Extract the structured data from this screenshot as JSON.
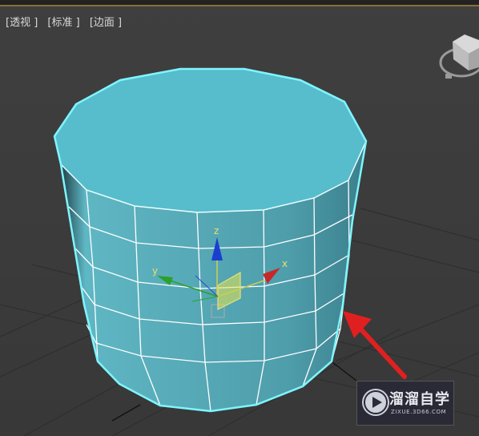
{
  "viewport": {
    "labels": [
      "[透视]",
      "[标准]",
      "[边面]"
    ],
    "label_texts": {
      "view": "[透视 ]",
      "shading": "[标准 ]",
      "edges": "[边面 ]"
    }
  },
  "gizmo": {
    "axis_x": "x",
    "axis_y": "y",
    "axis_z": "z"
  },
  "colors": {
    "mesh_fill": "#57bccb",
    "mesh_edge": "#ffffff",
    "selection_outline": "#7ff5ff",
    "axis_x": "#c62828",
    "axis_y": "#2aa12a",
    "axis_z": "#1a3fcf",
    "arrow": "#e02020"
  },
  "watermark": {
    "title": "溜溜自学",
    "url": "ZIXUE.3D66.COM"
  }
}
